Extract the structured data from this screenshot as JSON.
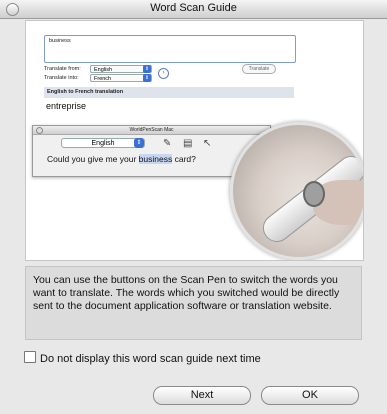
{
  "window": {
    "title": "Word Scan Guide"
  },
  "guide_image": {
    "input_text": "business",
    "translate_from_label": "Translate from:",
    "translate_from_value": "English",
    "translate_into_label": "Translate into:",
    "translate_into_value": "French",
    "translate_button": "Translate",
    "result_header": "English to French translation",
    "result_text": "entreprise",
    "wps_title": "WorldPenScan Mac",
    "wps_language": "English",
    "wps_text_before": "Could you give me your ",
    "wps_text_highlight": "business",
    "wps_text_after": " card?"
  },
  "description": "You can use the buttons on the Scan Pen to switch the words you want to translate. The words which you switched would be directly sent to the document application software or translation website.",
  "checkbox_label": "Do not display this word scan guide next time",
  "buttons": {
    "next": "Next",
    "ok": "OK"
  }
}
